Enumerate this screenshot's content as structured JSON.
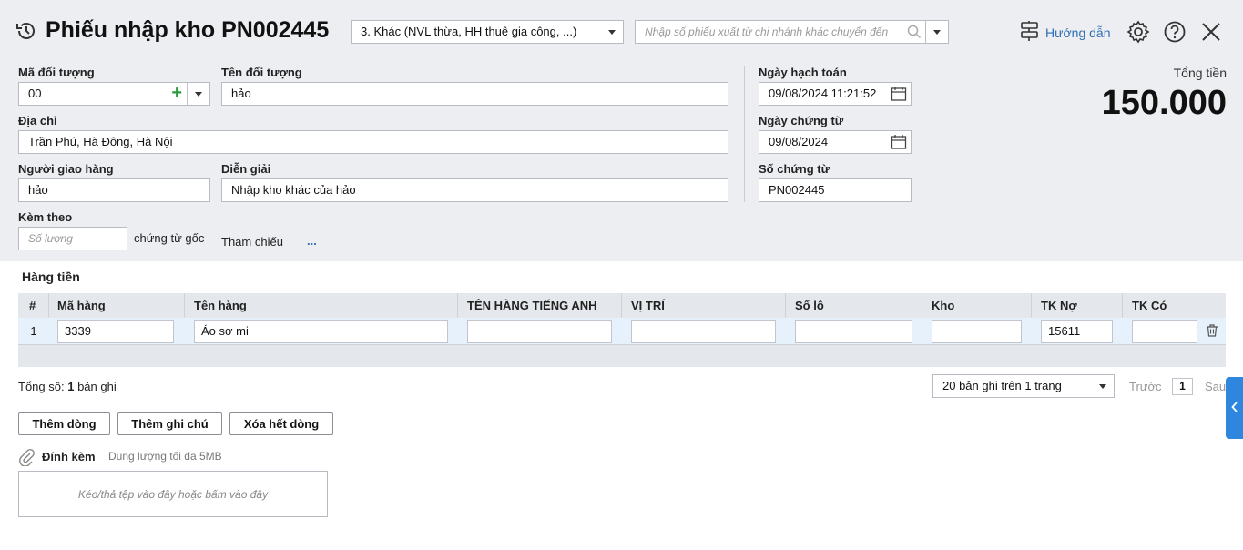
{
  "header": {
    "title": "Phiếu nhập kho PN002445",
    "type_select": "3. Khác (NVL thừa, HH thuê gia công, ...)",
    "transfer_placeholder": "Nhập số phiếu xuất từ chi nhánh khác chuyển đến",
    "guide_label": "Hướng dẫn",
    "icons": [
      "history-icon",
      "search-icon",
      "guide-icon",
      "gear-icon",
      "help-icon",
      "close-icon"
    ]
  },
  "form": {
    "ma_doi_tuong_label": "Mã đối tượng",
    "ma_doi_tuong_value": "00",
    "ten_doi_tuong_label": "Tên đối tượng",
    "ten_doi_tuong_value": "hảo",
    "dia_chi_label": "Địa chỉ",
    "dia_chi_value": "Trần Phú, Hà Đông, Hà Nội",
    "nguoi_giao_label": "Người giao hàng",
    "nguoi_giao_value": "hảo",
    "dien_giai_label": "Diễn giải",
    "dien_giai_value": "Nhập kho khác của hảo",
    "kem_theo_label": "Kèm theo",
    "so_luong_placeholder": "Số lượng",
    "chung_tu_goc_label": "chứng từ gốc",
    "tham_chieu_label": "Tham chiếu",
    "tham_chieu_more": "...",
    "ngay_hach_toan_label": "Ngày hạch toán",
    "ngay_hach_toan_value": "09/08/2024 11:21:52",
    "ngay_chung_tu_label": "Ngày chứng từ",
    "ngay_chung_tu_value": "09/08/2024",
    "so_chung_tu_label": "Số chứng từ",
    "so_chung_tu_value": "PN002445"
  },
  "total": {
    "label": "Tổng tiền",
    "value": "150.000"
  },
  "grid": {
    "section_title": "Hàng tiền",
    "columns": [
      "#",
      "Mã hàng",
      "Tên hàng",
      "TÊN HÀNG TIẾNG ANH",
      "VỊ TRÍ",
      "Số lô",
      "Kho",
      "TK Nợ",
      "TK Có"
    ],
    "rows": [
      {
        "no": "1",
        "ma_hang": "3339",
        "ten_hang": "Áo sơ mi",
        "ten_tieng_anh": "",
        "vi_tri": "",
        "so_lo": "",
        "kho": "",
        "tk_no": "15611",
        "tk_co": ""
      }
    ]
  },
  "footer": {
    "total_label": "Tổng số:",
    "total_count": "1",
    "total_unit": "bản ghi",
    "page_size": "20 bản ghi trên 1 trang",
    "prev_label": "Trước",
    "page": "1",
    "next_label": "Sau",
    "add_row": "Thêm dòng",
    "add_note": "Thêm ghi chú",
    "clear_rows": "Xóa hết dòng",
    "attach_label": "Đính kèm",
    "attach_limit": "Dung lượng tối đa 5MB",
    "dropzone_text": "Kéo/thả tệp vào đây hoặc bấm vào đây"
  },
  "colors": {
    "header_bg": "#eceef1",
    "accent_blue": "#2f6db5",
    "side_tab": "#2e86de",
    "add_green": "#2a9d3a",
    "row_highlight": "#e6f1fb"
  }
}
